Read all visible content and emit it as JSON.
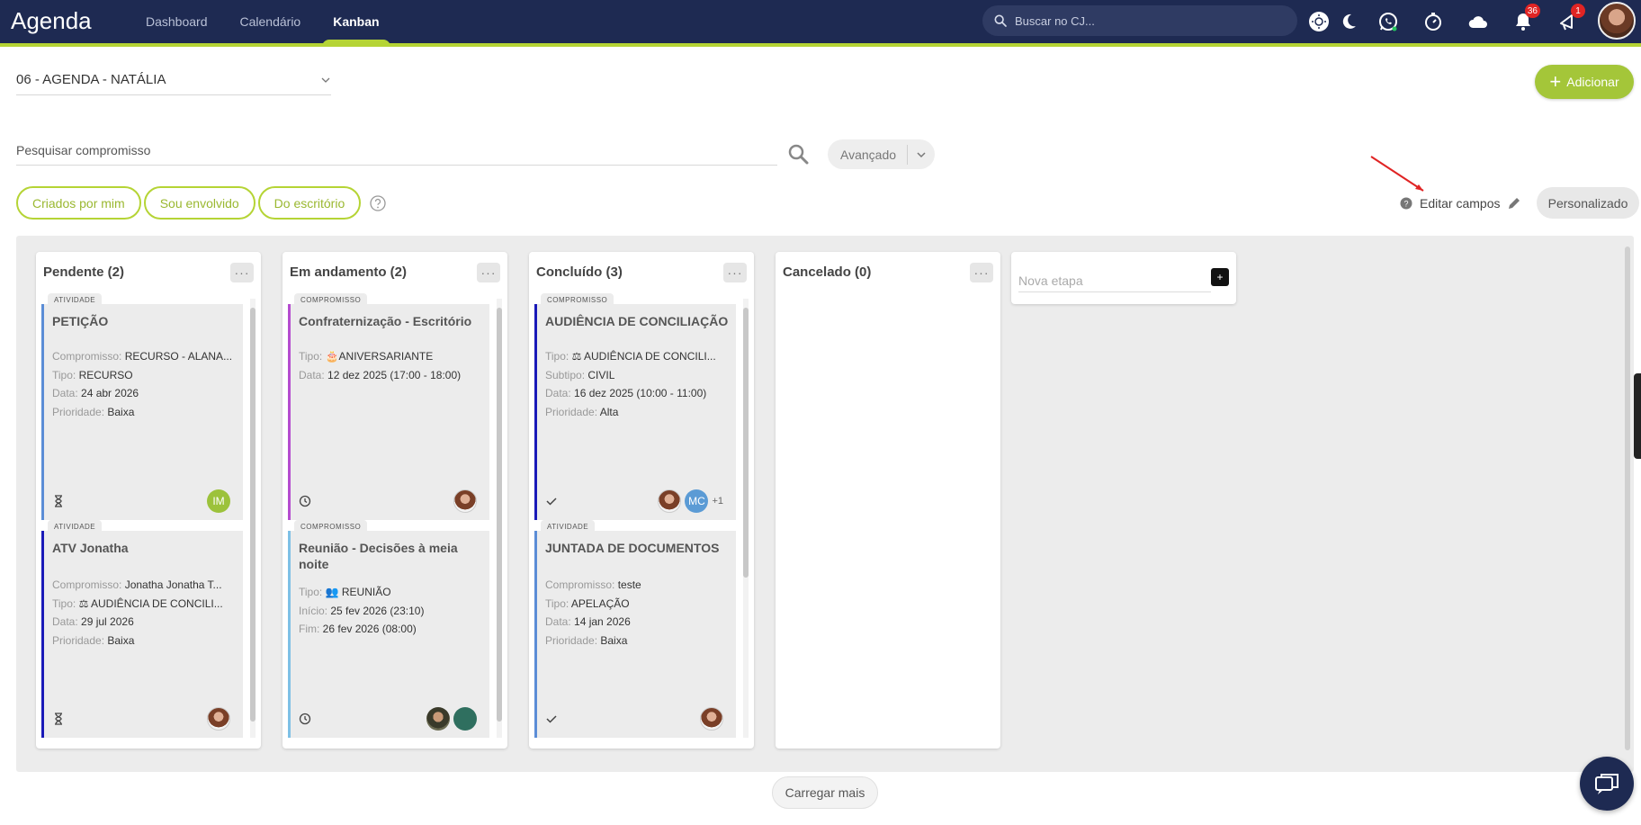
{
  "topbar": {
    "brand": "Agenda",
    "nav": [
      "Dashboard",
      "Calendário",
      "Kanban"
    ],
    "search_placeholder": "Buscar no CJ...",
    "notifications_count": "36",
    "alerts_count": "1"
  },
  "agenda_select": {
    "value": "06 - AGENDA - NATÁLIA"
  },
  "add_button": {
    "label": "Adicionar"
  },
  "search": {
    "placeholder": "Pesquisar compromisso",
    "advanced_label": "Avançado"
  },
  "filters": [
    "Criados por mim",
    "Sou envolvido",
    "Do escritório"
  ],
  "edit_fields": {
    "label": "Editar campos",
    "view_mode": "Personalizado"
  },
  "columns": [
    {
      "title": "Pendente (2)",
      "cards": [
        {
          "tag": "ATIVIDADE",
          "title": "PETIÇÃO",
          "fields": [
            {
              "k": "Compromisso:",
              "v": "RECURSO - ALANA..."
            },
            {
              "k": "Tipo:",
              "v": "RECURSO"
            },
            {
              "k": "Data:",
              "v": "24 abr 2026"
            },
            {
              "k": "Prioridade:",
              "v": "Baixa"
            }
          ],
          "avatar_initials": "IM"
        },
        {
          "tag": "ATIVIDADE",
          "title": "ATV Jonatha",
          "fields": [
            {
              "k": "Compromisso:",
              "v": "Jonatha Jonatha T..."
            },
            {
              "k": "Tipo:",
              "v": "AUDIÊNCIA DE CONCILI..."
            },
            {
              "k": "Data:",
              "v": "29 jul 2026"
            },
            {
              "k": "Prioridade:",
              "v": "Baixa"
            }
          ]
        }
      ]
    },
    {
      "title": "Em andamento (2)",
      "cards": [
        {
          "tag": "COMPROMISSO",
          "title": "Confraternização - Escritório",
          "fields": [
            {
              "k": "Tipo:",
              "v": "ANIVERSARIANTE"
            },
            {
              "k": "Data:",
              "v": "12 dez 2025 (17:00 - 18:00)"
            }
          ]
        },
        {
          "tag": "COMPROMISSO",
          "title": "Reunião - Decisões à meia noite",
          "fields": [
            {
              "k": "Tipo:",
              "v": "REUNIÃO"
            },
            {
              "k": "Início:",
              "v": "25 fev 2026 (23:10)"
            },
            {
              "k": "Fim:",
              "v": "26 fev 2026 (08:00)"
            }
          ]
        }
      ]
    },
    {
      "title": "Concluído (3)",
      "cards": [
        {
          "tag": "COMPROMISSO",
          "title": "AUDIÊNCIA DE CONCILIAÇÃO",
          "fields": [
            {
              "k": "Tipo:",
              "v": "AUDIÊNCIA DE CONCILI..."
            },
            {
              "k": "Subtipo:",
              "v": "CIVIL"
            },
            {
              "k": "Data:",
              "v": "16 dez 2025 (10:00 - 11:00)"
            },
            {
              "k": "Prioridade:",
              "v": "Alta"
            }
          ],
          "avatar_initials": "MC",
          "more": "+1"
        },
        {
          "tag": "ATIVIDADE",
          "title": "JUNTADA DE DOCUMENTOS",
          "fields": [
            {
              "k": "Compromisso:",
              "v": "teste"
            },
            {
              "k": "Tipo:",
              "v": "APELAÇÃO"
            },
            {
              "k": "Data:",
              "v": "14 jan 2026"
            },
            {
              "k": "Prioridade:",
              "v": "Baixa"
            }
          ]
        }
      ]
    },
    {
      "title": "Cancelado (0)",
      "cards": []
    }
  ],
  "new_stage": {
    "placeholder": "Nova etapa",
    "add": "+"
  },
  "load_more": "Carregar mais",
  "colors": {
    "navy": "#1e2a52",
    "accent": "#b5d435",
    "button_green": "#a4c639"
  }
}
